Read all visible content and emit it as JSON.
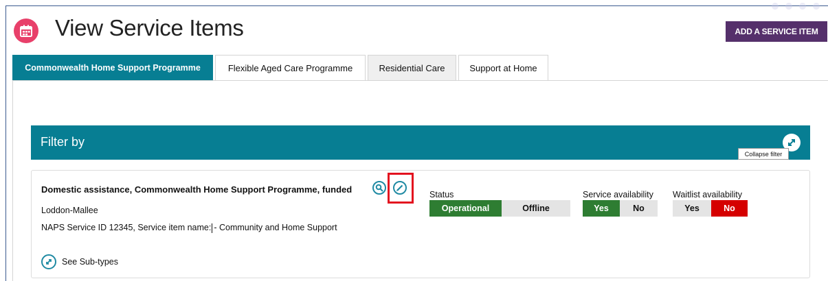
{
  "header": {
    "title": "View Service Items",
    "add_button": "ADD A SERVICE ITEM",
    "brand_color": "#e8406a",
    "accent_color": "#55306b"
  },
  "tabs": [
    {
      "label": "Commonwealth Home Support Programme",
      "active": true
    },
    {
      "label": "Flexible Aged Care Programme",
      "active": false
    },
    {
      "label": "Residential Care",
      "active": false
    },
    {
      "label": "Support at Home",
      "active": false
    }
  ],
  "filter": {
    "title": "Filter by",
    "collapse_tooltip": "Collapse filter",
    "bar_color": "#077e93"
  },
  "service_item": {
    "title": "Domestic assistance, Commonwealth Home Support Programme, funded",
    "region": "Loddon-Mallee",
    "naps_prefix": "NAPS Service ID 12345, Service item name:",
    "naps_suffix": "- Community and Home Support",
    "see_subtypes": "See Sub-types",
    "icons": [
      "search-icon",
      "edit-pencil-icon",
      "expand-icon"
    ]
  },
  "status": {
    "label": "Status",
    "options": [
      "Operational",
      "Offline"
    ],
    "selected": "Operational"
  },
  "service_availability": {
    "label": "Service availability",
    "options": [
      "Yes",
      "No"
    ],
    "selected": "Yes"
  },
  "waitlist_availability": {
    "label": "Waitlist availability",
    "options": [
      "Yes",
      "No"
    ],
    "selected": "No"
  }
}
